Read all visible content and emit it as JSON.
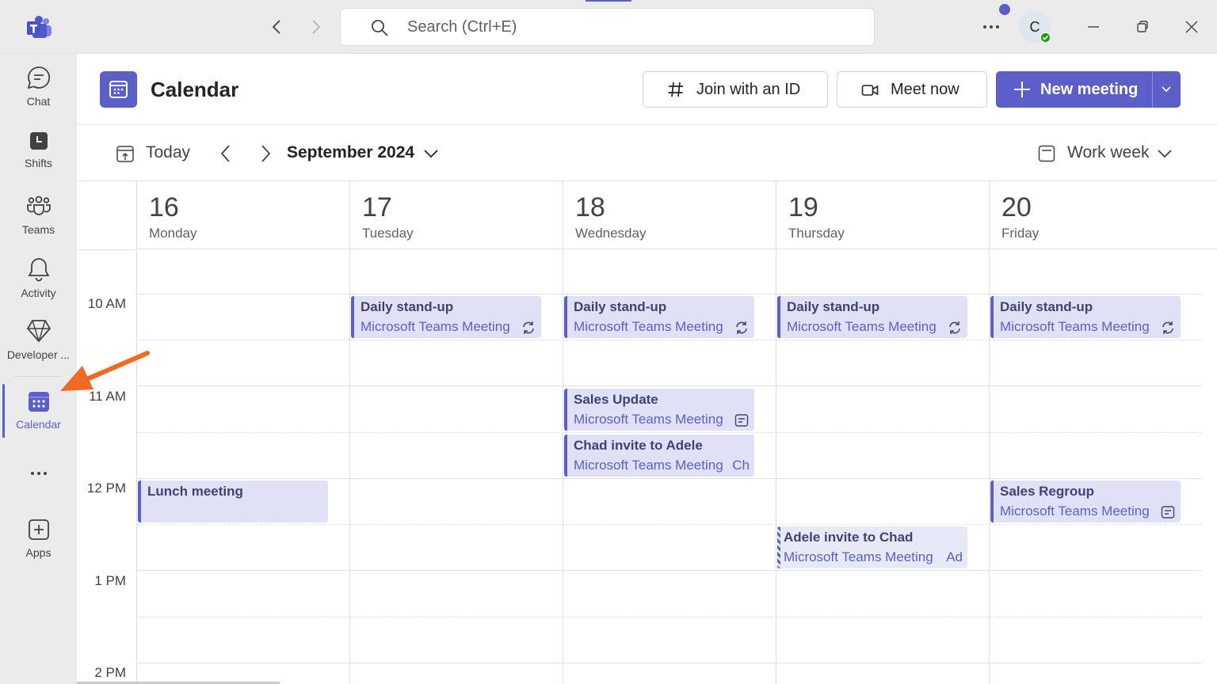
{
  "titlebar": {
    "search_placeholder": "Search (Ctrl+E)",
    "avatar_initial": "C"
  },
  "rail": {
    "items": [
      {
        "label": "Chat"
      },
      {
        "label": "Shifts"
      },
      {
        "label": "Teams"
      },
      {
        "label": "Activity"
      },
      {
        "label": "Developer ..."
      },
      {
        "label": "Calendar"
      },
      {
        "label": "Apps"
      }
    ]
  },
  "header": {
    "title": "Calendar",
    "join_label": "Join with an ID",
    "meet_label": "Meet now",
    "new_label": "New meeting"
  },
  "toolbar": {
    "today_label": "Today",
    "month_label": "September 2024",
    "view_label": "Work week"
  },
  "days": [
    {
      "num": "16",
      "name": "Monday"
    },
    {
      "num": "17",
      "name": "Tuesday"
    },
    {
      "num": "18",
      "name": "Wednesday"
    },
    {
      "num": "19",
      "name": "Thursday"
    },
    {
      "num": "20",
      "name": "Friday"
    }
  ],
  "times": [
    "10 AM",
    "11 AM",
    "12 PM",
    "1 PM",
    "2 PM"
  ],
  "events": [
    {
      "title": "Daily stand-up",
      "subtitle": "Microsoft Teams Meeting",
      "icon": "recurring-icon"
    },
    {
      "title": "Daily stand-up",
      "subtitle": "Microsoft Teams Meeting",
      "icon": "recurring-icon"
    },
    {
      "title": "Daily stand-up",
      "subtitle": "Microsoft Teams Meeting",
      "icon": "recurring-icon"
    },
    {
      "title": "Daily stand-up",
      "subtitle": "Microsoft Teams Meeting",
      "icon": "recurring-icon"
    },
    {
      "title": "Sales Update",
      "subtitle": "Microsoft Teams Meeting",
      "icon": "meeting-notes-icon"
    },
    {
      "title": "Chad invite to Adele",
      "subtitle": "Microsoft Teams Meeting",
      "trail": "Ch"
    },
    {
      "title": "Lunch meeting"
    },
    {
      "title": "Sales Regroup",
      "subtitle": "Microsoft Teams Meeting",
      "icon": "meeting-notes-icon"
    },
    {
      "title": "Adele invite to Chad",
      "subtitle": "Microsoft Teams Meeting",
      "trail": "Ad"
    }
  ],
  "colors": {
    "accent": "#5b5fc7",
    "event_bg": "#e0e1f7",
    "annotation_arrow": "#f26a21",
    "presence": "#13a10e"
  }
}
